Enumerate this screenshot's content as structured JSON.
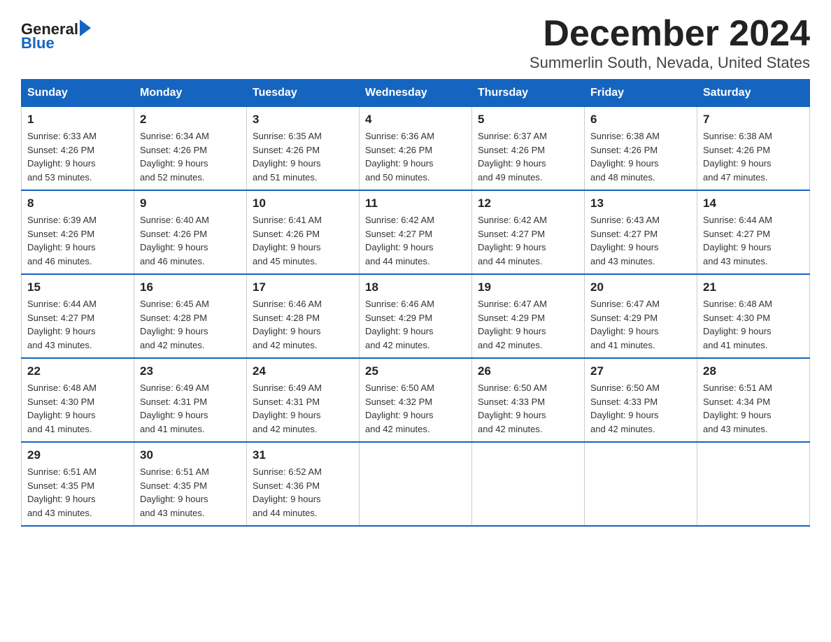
{
  "logo": {
    "text_general": "General",
    "text_blue": "Blue",
    "arrow": "▶"
  },
  "title": "December 2024",
  "subtitle": "Summerlin South, Nevada, United States",
  "weekdays": [
    "Sunday",
    "Monday",
    "Tuesday",
    "Wednesday",
    "Thursday",
    "Friday",
    "Saturday"
  ],
  "weeks": [
    [
      {
        "day": "1",
        "sunrise": "6:33 AM",
        "sunset": "4:26 PM",
        "daylight": "9 hours and 53 minutes."
      },
      {
        "day": "2",
        "sunrise": "6:34 AM",
        "sunset": "4:26 PM",
        "daylight": "9 hours and 52 minutes."
      },
      {
        "day": "3",
        "sunrise": "6:35 AM",
        "sunset": "4:26 PM",
        "daylight": "9 hours and 51 minutes."
      },
      {
        "day": "4",
        "sunrise": "6:36 AM",
        "sunset": "4:26 PM",
        "daylight": "9 hours and 50 minutes."
      },
      {
        "day": "5",
        "sunrise": "6:37 AM",
        "sunset": "4:26 PM",
        "daylight": "9 hours and 49 minutes."
      },
      {
        "day": "6",
        "sunrise": "6:38 AM",
        "sunset": "4:26 PM",
        "daylight": "9 hours and 48 minutes."
      },
      {
        "day": "7",
        "sunrise": "6:38 AM",
        "sunset": "4:26 PM",
        "daylight": "9 hours and 47 minutes."
      }
    ],
    [
      {
        "day": "8",
        "sunrise": "6:39 AM",
        "sunset": "4:26 PM",
        "daylight": "9 hours and 46 minutes."
      },
      {
        "day": "9",
        "sunrise": "6:40 AM",
        "sunset": "4:26 PM",
        "daylight": "9 hours and 46 minutes."
      },
      {
        "day": "10",
        "sunrise": "6:41 AM",
        "sunset": "4:26 PM",
        "daylight": "9 hours and 45 minutes."
      },
      {
        "day": "11",
        "sunrise": "6:42 AM",
        "sunset": "4:27 PM",
        "daylight": "9 hours and 44 minutes."
      },
      {
        "day": "12",
        "sunrise": "6:42 AM",
        "sunset": "4:27 PM",
        "daylight": "9 hours and 44 minutes."
      },
      {
        "day": "13",
        "sunrise": "6:43 AM",
        "sunset": "4:27 PM",
        "daylight": "9 hours and 43 minutes."
      },
      {
        "day": "14",
        "sunrise": "6:44 AM",
        "sunset": "4:27 PM",
        "daylight": "9 hours and 43 minutes."
      }
    ],
    [
      {
        "day": "15",
        "sunrise": "6:44 AM",
        "sunset": "4:27 PM",
        "daylight": "9 hours and 43 minutes."
      },
      {
        "day": "16",
        "sunrise": "6:45 AM",
        "sunset": "4:28 PM",
        "daylight": "9 hours and 42 minutes."
      },
      {
        "day": "17",
        "sunrise": "6:46 AM",
        "sunset": "4:28 PM",
        "daylight": "9 hours and 42 minutes."
      },
      {
        "day": "18",
        "sunrise": "6:46 AM",
        "sunset": "4:29 PM",
        "daylight": "9 hours and 42 minutes."
      },
      {
        "day": "19",
        "sunrise": "6:47 AM",
        "sunset": "4:29 PM",
        "daylight": "9 hours and 42 minutes."
      },
      {
        "day": "20",
        "sunrise": "6:47 AM",
        "sunset": "4:29 PM",
        "daylight": "9 hours and 41 minutes."
      },
      {
        "day": "21",
        "sunrise": "6:48 AM",
        "sunset": "4:30 PM",
        "daylight": "9 hours and 41 minutes."
      }
    ],
    [
      {
        "day": "22",
        "sunrise": "6:48 AM",
        "sunset": "4:30 PM",
        "daylight": "9 hours and 41 minutes."
      },
      {
        "day": "23",
        "sunrise": "6:49 AM",
        "sunset": "4:31 PM",
        "daylight": "9 hours and 41 minutes."
      },
      {
        "day": "24",
        "sunrise": "6:49 AM",
        "sunset": "4:31 PM",
        "daylight": "9 hours and 42 minutes."
      },
      {
        "day": "25",
        "sunrise": "6:50 AM",
        "sunset": "4:32 PM",
        "daylight": "9 hours and 42 minutes."
      },
      {
        "day": "26",
        "sunrise": "6:50 AM",
        "sunset": "4:33 PM",
        "daylight": "9 hours and 42 minutes."
      },
      {
        "day": "27",
        "sunrise": "6:50 AM",
        "sunset": "4:33 PM",
        "daylight": "9 hours and 42 minutes."
      },
      {
        "day": "28",
        "sunrise": "6:51 AM",
        "sunset": "4:34 PM",
        "daylight": "9 hours and 43 minutes."
      }
    ],
    [
      {
        "day": "29",
        "sunrise": "6:51 AM",
        "sunset": "4:35 PM",
        "daylight": "9 hours and 43 minutes."
      },
      {
        "day": "30",
        "sunrise": "6:51 AM",
        "sunset": "4:35 PM",
        "daylight": "9 hours and 43 minutes."
      },
      {
        "day": "31",
        "sunrise": "6:52 AM",
        "sunset": "4:36 PM",
        "daylight": "9 hours and 44 minutes."
      },
      null,
      null,
      null,
      null
    ]
  ],
  "labels": {
    "sunrise": "Sunrise:",
    "sunset": "Sunset:",
    "daylight": "Daylight:"
  }
}
